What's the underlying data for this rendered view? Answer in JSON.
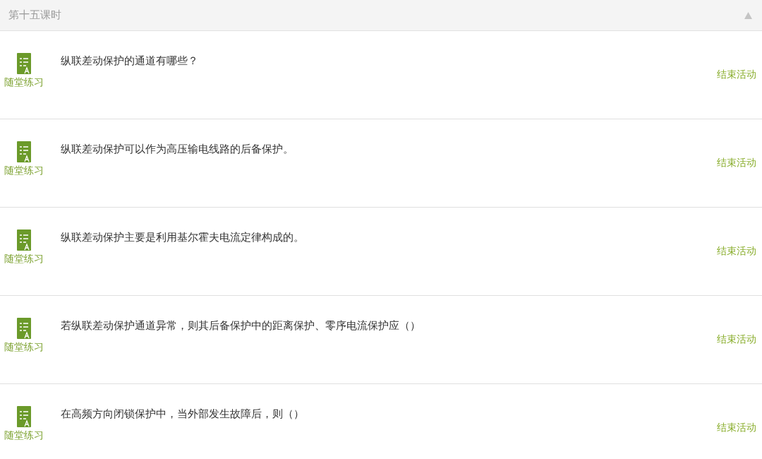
{
  "section": {
    "title": "第十五课时"
  },
  "activities": [
    {
      "type_label": "随堂练习",
      "question": "纵联差动保护的通道有哪些？",
      "action": "结束活动"
    },
    {
      "type_label": "随堂练习",
      "question": "纵联差动保护可以作为高压输电线路的后备保护。",
      "action": "结束活动"
    },
    {
      "type_label": "随堂练习",
      "question": "纵联差动保护主要是利用基尔霍夫电流定律构成的。",
      "action": "结束活动"
    },
    {
      "type_label": "随堂练习",
      "question": "若纵联差动保护通道异常，则其后备保护中的距离保护、零序电流保护应（）",
      "action": "结束活动"
    },
    {
      "type_label": "随堂练习",
      "question": "在高频方向闭锁保护中，当外部发生故障后，则（）",
      "action": "结束活动"
    }
  ]
}
